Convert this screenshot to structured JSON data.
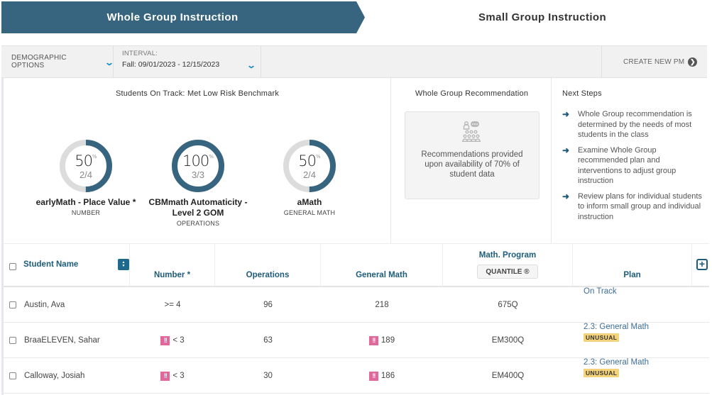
{
  "tabs": {
    "whole_group": "Whole Group Instruction",
    "small_group": "Small Group Instruction"
  },
  "toolbar": {
    "demographic_label": "DEMOGRAPHIC OPTIONS",
    "interval_label": "INTERVAL:",
    "interval_value": "Fall: 09/01/2023 - 12/15/2023",
    "create_label": "CREATE NEW PM"
  },
  "on_track": {
    "title": "Students On Track: Met Low Risk Benchmark",
    "items": [
      {
        "percent": "50",
        "percent_sign": "%",
        "fraction": "2/4",
        "met": 2,
        "total": 4,
        "name": "earlyMath - Place Value *",
        "domain": "NUMBER"
      },
      {
        "percent": "100",
        "percent_sign": "%",
        "fraction": "3/3",
        "met": 3,
        "total": 3,
        "name": "CBMmath Automaticity - Level 2 GOM",
        "domain": "OPERATIONS"
      },
      {
        "percent": "50",
        "percent_sign": "%",
        "fraction": "2/4",
        "met": 2,
        "total": 4,
        "name": "aMath",
        "domain": "GENERAL MATH"
      }
    ]
  },
  "recommendation": {
    "title": "Whole Group Recommendation",
    "icon": "classroom-icon",
    "text": "Recommendations provided upon availability of 70% of student data"
  },
  "next_steps": {
    "title": "Next Steps",
    "items": [
      "Whole Group recommendation is determined by the needs of most students in the class",
      "Examine Whole Group recommended plan and interventions to adjust group instruction",
      "Review plans for individual students to inform small group and individual instruction"
    ]
  },
  "table": {
    "headers": {
      "student_name": "Student Name",
      "number": "Number *",
      "operations": "Operations",
      "general_math": "General Math",
      "math_program": "Math. Program",
      "quantile": "QUANTILE ®",
      "plan": "Plan"
    },
    "rows": [
      {
        "name": "Austin, Ava",
        "number": ">= 4",
        "number_flag": false,
        "operations": "96",
        "general_math": "218",
        "general_flag": false,
        "math_program": "675Q",
        "plan": "On Track",
        "plan_badge": ""
      },
      {
        "name": "BraaELEVEN, Sahar",
        "number": "< 3",
        "number_flag": true,
        "operations": "63",
        "general_math": "189",
        "general_flag": true,
        "math_program": "EM300Q",
        "plan": "2.3: General Math",
        "plan_badge": "UNUSUAL"
      },
      {
        "name": "Calloway, Josiah",
        "number": "< 3",
        "number_flag": true,
        "operations": "30",
        "general_math": "186",
        "general_flag": true,
        "math_program": "EM400Q",
        "plan": "2.3: General Math",
        "plan_badge": "UNUSUAL"
      }
    ],
    "flag_glyph": "!!"
  },
  "colors": {
    "primary": "#37647f",
    "header_text": "#1d5c7a",
    "donut_track": "#dcdcdc",
    "flag": "#e0689a",
    "badge": "#f5d37a",
    "link": "#3d6e96"
  }
}
